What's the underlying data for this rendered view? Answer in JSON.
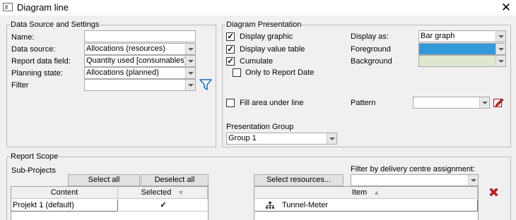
{
  "window": {
    "title": "Diagram line"
  },
  "data_source": {
    "legend": "Data Source and Settings",
    "name_label": "Name:",
    "name_value": "",
    "source_label": "Data source:",
    "source_value": "Allocations (resources)",
    "field_label": "Report data field:",
    "field_value": "Quantity used [consumables]",
    "planning_label": "Planning state:",
    "planning_value": "Allocations (planned)",
    "filter_label": "Filter",
    "filter_value": ""
  },
  "presentation": {
    "legend": "Diagram Presentation",
    "display_graphic": "Display graphic",
    "display_value_table": "Display value table",
    "cumulate": "Cumulate",
    "only_to_report_date": "Only to Report Date",
    "fill_area": "Fill area under line",
    "display_as_label": "Display as:",
    "display_as_value": "Bar graph",
    "foreground_label": "Foreground",
    "background_label": "Background",
    "pattern_label": "Pattern",
    "group_label": "Presentation Group",
    "group_value": "Group 1",
    "colors": {
      "foreground": "#3399d8",
      "background": "#dfe7cf",
      "label_blue": "#000000"
    }
  },
  "report_scope": {
    "legend": "Report Scope",
    "sub_projects_label": "Sub-Projects",
    "select_all": "Select all",
    "deselect_all": "Deselect all",
    "col_content": "Content",
    "col_selected": "Selected",
    "rows": [
      {
        "content": "Projekt 1 (default)",
        "selected": "✓"
      }
    ],
    "select_resources": "Select resources...",
    "filter_label": "Filter by delivery centre assignment:",
    "filter_value": "",
    "col_item": "Item",
    "items": [
      {
        "label": "Tunnel-Meter"
      }
    ],
    "icons": {
      "delete": "red-x-icon",
      "hierarchy": "hierarchy-icon",
      "funnel": "funnel-icon",
      "edit": "edit-pattern-icon"
    }
  }
}
